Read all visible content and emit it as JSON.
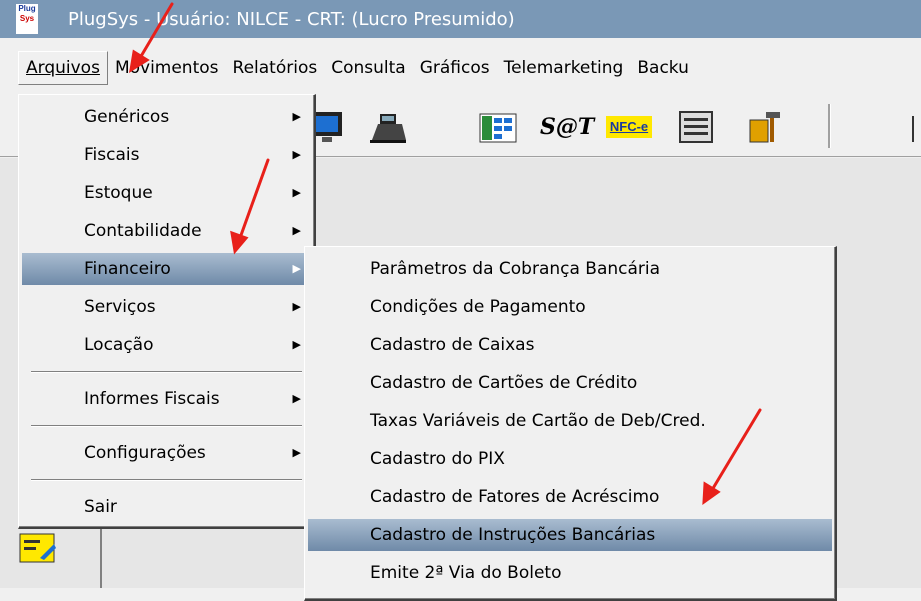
{
  "window": {
    "title": "PlugSys - Usuário: NILCE   -   CRT: (Lucro Presumido)",
    "app_icon_top": "Plug",
    "app_icon_bottom": "Sys"
  },
  "menubar": {
    "items": [
      {
        "label": "Arquivos",
        "access_key": "A"
      },
      {
        "label": "Movimentos",
        "access_key": "M"
      },
      {
        "label": "Relatórios",
        "access_key": "R"
      },
      {
        "label": "Consulta",
        "access_key": "C"
      },
      {
        "label": "Gráficos",
        "access_key": "G"
      },
      {
        "label": "Telemarketing",
        "access_key": "T"
      },
      {
        "label": "Backu",
        "access_key": ""
      }
    ]
  },
  "toolbar": {
    "icons": [
      "monitor-icon",
      "cash-register-icon",
      "spreadsheet-icon",
      "sat-icon",
      "nfce-icon",
      "form-icon",
      "tools-icon"
    ],
    "sat_label": "S@T",
    "nfce_label": "NFC-e"
  },
  "arquivos_menu": {
    "items": [
      {
        "label": "Genéricos",
        "has_submenu": true
      },
      {
        "label": "Fiscais",
        "has_submenu": true
      },
      {
        "label": "Estoque",
        "has_submenu": true
      },
      {
        "label": "Contabilidade",
        "has_submenu": true
      },
      {
        "label": "Financeiro",
        "has_submenu": true,
        "highlighted": true
      },
      {
        "label": "Serviços",
        "has_submenu": true
      },
      {
        "label": "Locação",
        "has_submenu": true
      },
      {
        "label": "Informes Fiscais",
        "has_submenu": true
      },
      {
        "label": "Configurações",
        "has_submenu": true
      },
      {
        "label": "Sair",
        "has_submenu": false
      }
    ]
  },
  "financeiro_submenu": {
    "items": [
      {
        "label": "Parâmetros da Cobrança Bancária"
      },
      {
        "label": "Condições de Pagamento"
      },
      {
        "label": "Cadastro de Caixas"
      },
      {
        "label": "Cadastro de Cartões de Crédito"
      },
      {
        "label": "Taxas Variáveis de Cartão de Deb/Cred."
      },
      {
        "label": "Cadastro do PIX"
      },
      {
        "label": "Cadastro de Fatores de Acréscimo"
      },
      {
        "label": "Cadastro de Instruções Bancárias",
        "highlighted": true
      },
      {
        "label": "Emite 2ª Via do Boleto"
      }
    ]
  },
  "colors": {
    "titlebar": "#7a98b6",
    "highlight": "#8aa3bd",
    "annotation_arrow": "#e8201a"
  }
}
